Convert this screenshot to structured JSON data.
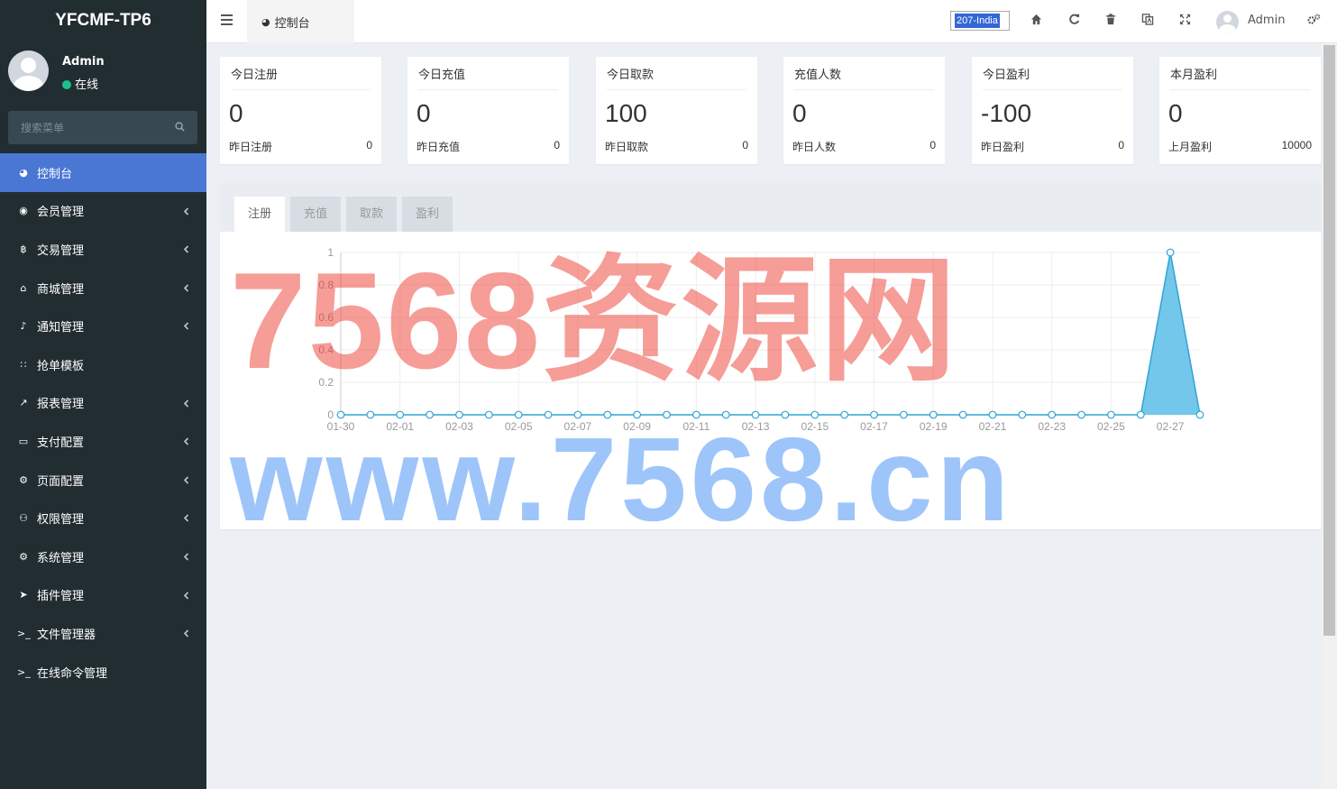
{
  "app": {
    "title": "YFCMF-TP6"
  },
  "user": {
    "name": "Admin",
    "status": "在线"
  },
  "search": {
    "placeholder": "搜索菜单"
  },
  "menu": [
    {
      "label": "控制台",
      "icon": "dashboard-icon",
      "active": true,
      "has_children": false
    },
    {
      "label": "会员管理",
      "icon": "user-circle-icon",
      "has_children": true
    },
    {
      "label": "交易管理",
      "icon": "bitcoin-icon",
      "has_children": true
    },
    {
      "label": "商城管理",
      "icon": "home-icon",
      "has_children": true
    },
    {
      "label": "通知管理",
      "icon": "bell-icon",
      "has_children": true
    },
    {
      "label": "抢单模板",
      "icon": "sitemap-icon",
      "has_children": false
    },
    {
      "label": "报表管理",
      "icon": "line-chart-icon",
      "has_children": true
    },
    {
      "label": "支付配置",
      "icon": "credit-card-icon",
      "has_children": true
    },
    {
      "label": "页面配置",
      "icon": "gear-icon",
      "has_children": true
    },
    {
      "label": "权限管理",
      "icon": "users-icon",
      "has_children": true
    },
    {
      "label": "系统管理",
      "icon": "gears-icon",
      "has_children": true
    },
    {
      "label": "插件管理",
      "icon": "rocket-icon",
      "has_children": true
    },
    {
      "label": "文件管理器",
      "icon": "terminal-icon",
      "has_children": true
    },
    {
      "label": "在线命令管理",
      "icon": "terminal-icon",
      "has_children": false
    }
  ],
  "topbar": {
    "tab_label": "控制台",
    "language": "207-India",
    "user_name": "Admin"
  },
  "stats": [
    {
      "title": "今日注册",
      "value": "0",
      "sub_label": "昨日注册",
      "sub_value": "0"
    },
    {
      "title": "今日充值",
      "value": "0",
      "sub_label": "昨日充值",
      "sub_value": "0"
    },
    {
      "title": "今日取款",
      "value": "100",
      "sub_label": "昨日取款",
      "sub_value": "0"
    },
    {
      "title": "充值人数",
      "value": "0",
      "sub_label": "昨日人数",
      "sub_value": "0"
    },
    {
      "title": "今日盈利",
      "value": "-100",
      "sub_label": "昨日盈利",
      "sub_value": "0"
    },
    {
      "title": "本月盈利",
      "value": "0",
      "sub_label": "上月盈利",
      "sub_value": "10000"
    }
  ],
  "chart_tabs": [
    "注册",
    "充值",
    "取款",
    "盈利"
  ],
  "watermark": {
    "line1": "7568资源网",
    "line2": "www.7568.cn"
  },
  "colors": {
    "sidebar_bg": "#222d32",
    "active_menu": "#4a77d4",
    "series_fill": "#5bbde6",
    "series_line": "#2fa4d6"
  },
  "chart_data": {
    "type": "area",
    "x": [
      "01-30",
      "01-31",
      "02-01",
      "02-02",
      "02-03",
      "02-04",
      "02-05",
      "02-06",
      "02-07",
      "02-08",
      "02-09",
      "02-10",
      "02-11",
      "02-12",
      "02-13",
      "02-14",
      "02-15",
      "02-16",
      "02-17",
      "02-18",
      "02-19",
      "02-20",
      "02-21",
      "02-22",
      "02-23",
      "02-24",
      "02-25",
      "02-26",
      "02-27",
      "02-28"
    ],
    "x_tick_labels": [
      "01-30",
      "02-01",
      "02-03",
      "02-05",
      "02-07",
      "02-09",
      "02-11",
      "02-13",
      "02-15",
      "02-17",
      "02-19",
      "02-21",
      "02-23",
      "02-25",
      "02-27"
    ],
    "series": [
      {
        "values": [
          0,
          0,
          0,
          0,
          0,
          0,
          0,
          0,
          0,
          0,
          0,
          0,
          0,
          0,
          0,
          0,
          0,
          0,
          0,
          0,
          0,
          0,
          0,
          0,
          0,
          0,
          0,
          0,
          1,
          0
        ]
      }
    ],
    "y_ticks": [
      "0",
      "0.2",
      "0.4",
      "0.6",
      "0.8",
      "1"
    ],
    "ylim": [
      0,
      1
    ],
    "grid": true
  }
}
